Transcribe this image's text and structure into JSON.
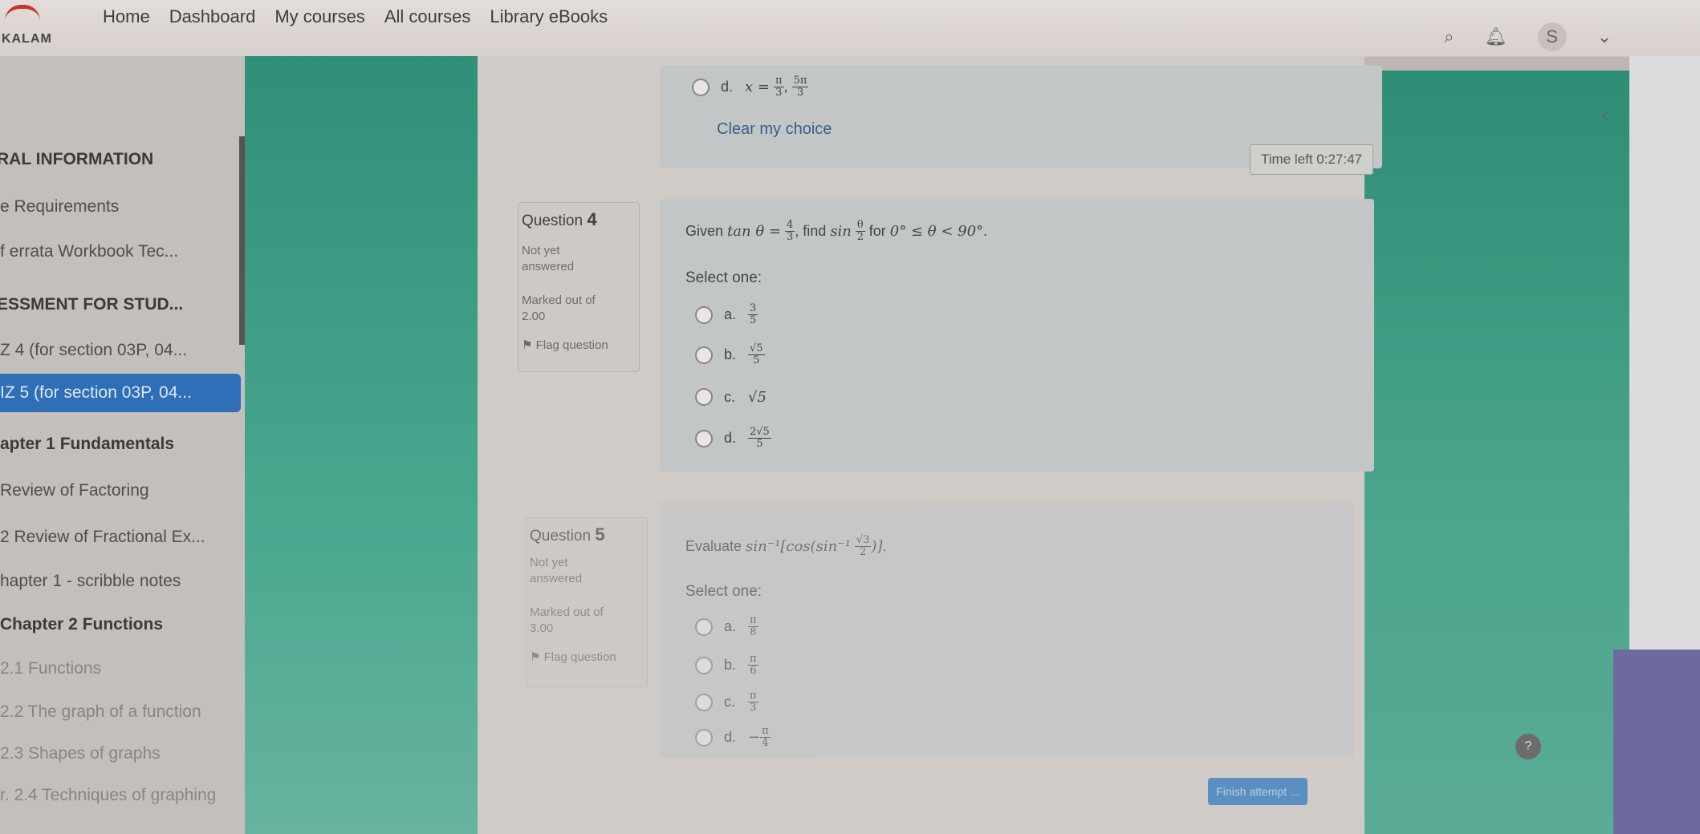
{
  "header": {
    "brand": "KALAM",
    "nav": [
      "Home",
      "Dashboard",
      "My courses",
      "All courses",
      "Library eBooks"
    ],
    "icons": [
      "search-icon",
      "notification-icon",
      "avatar"
    ],
    "avatar_letter": "S"
  },
  "drawer": {
    "items": [
      {
        "label": "RAL INFORMATION"
      },
      {
        "label": "e Requirements"
      },
      {
        "label": "f errata Workbook Tec..."
      },
      {
        "label": "ESSMENT FOR STUD..."
      },
      {
        "label": "Z 4 (for section 03P, 04..."
      },
      {
        "label": "IZ 5 (for section 03P, 04..."
      },
      {
        "label": "apter 1 Fundamentals"
      },
      {
        "label": "Review of Factoring"
      },
      {
        "label": "2 Review of Fractional Ex..."
      },
      {
        "label": "hapter 1 - scribble notes"
      },
      {
        "label": "Chapter 2 Functions"
      },
      {
        "label": "2.1 Functions"
      },
      {
        "label": "2.2 The graph of a function"
      },
      {
        "label": "2.3 Shapes of graphs"
      },
      {
        "label": "r. 2.4 Techniques of graphing"
      }
    ]
  },
  "prev_question": {
    "option_d_letter": "d.",
    "option_d_value": "x = π/3, 5π/3",
    "clear_label": "Clear my choice"
  },
  "timer": "Time left 0:27:47",
  "q4": {
    "label": "Question",
    "number": "4",
    "status1": "Not yet",
    "status2": "answered",
    "marked1": "Marked out of",
    "marked2": "2.00",
    "flag": "Flag question",
    "prompt_given": "Given",
    "prompt_find": ", find",
    "prompt_for": "for",
    "select": "Select one:",
    "options": [
      {
        "letter": "a.",
        "value": "3/5"
      },
      {
        "letter": "b.",
        "value": "√5/5"
      },
      {
        "letter": "c.",
        "value": "√5"
      },
      {
        "letter": "d.",
        "value": "2√5/5"
      }
    ]
  },
  "q5": {
    "label": "Question",
    "number": "5",
    "status1": "Not yet",
    "status2": "answered",
    "marked1": "Marked out of",
    "marked2": "3.00",
    "flag": "Flag question",
    "prompt": "Evaluate",
    "select": "Select one:",
    "options": [
      {
        "letter": "a.",
        "value": "π/8"
      },
      {
        "letter": "b.",
        "value": "π/6"
      },
      {
        "letter": "c.",
        "value": "π/3"
      },
      {
        "letter": "d.",
        "value": "−π/4"
      }
    ]
  },
  "finish_label": "Finish attempt ...",
  "help_label": "?"
}
